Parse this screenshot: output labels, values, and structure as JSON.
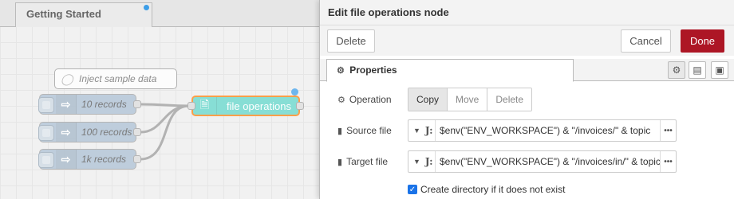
{
  "workspace": {
    "tab_label": "Getting Started",
    "comment_node": "Inject sample data",
    "inject_nodes": [
      "10 records",
      "100 records",
      "1k records"
    ],
    "file_node": "file operations"
  },
  "tray": {
    "title": "Edit file operations node",
    "delete_label": "Delete",
    "cancel_label": "Cancel",
    "done_label": "Done",
    "properties_tab": "Properties",
    "operation_label": "Operation",
    "operations": [
      "Copy",
      "Move",
      "Delete"
    ],
    "selected_operation": "Copy",
    "source_label": "Source file",
    "source_value": "$env(\"ENV_WORKSPACE\") & \"/invoices/\" & topic",
    "target_label": "Target file",
    "target_value": "$env(\"ENV_WORKSPACE\") & \"/invoices/in/\" & topic",
    "create_dir_label": "Create directory if it does not exist",
    "create_dir_checked": true
  },
  "colors": {
    "done_button": "#ad1625",
    "file_node": "#5fd3c7",
    "inject_node": "#a6bbcf",
    "changed_dot": "#3c9ee8"
  }
}
